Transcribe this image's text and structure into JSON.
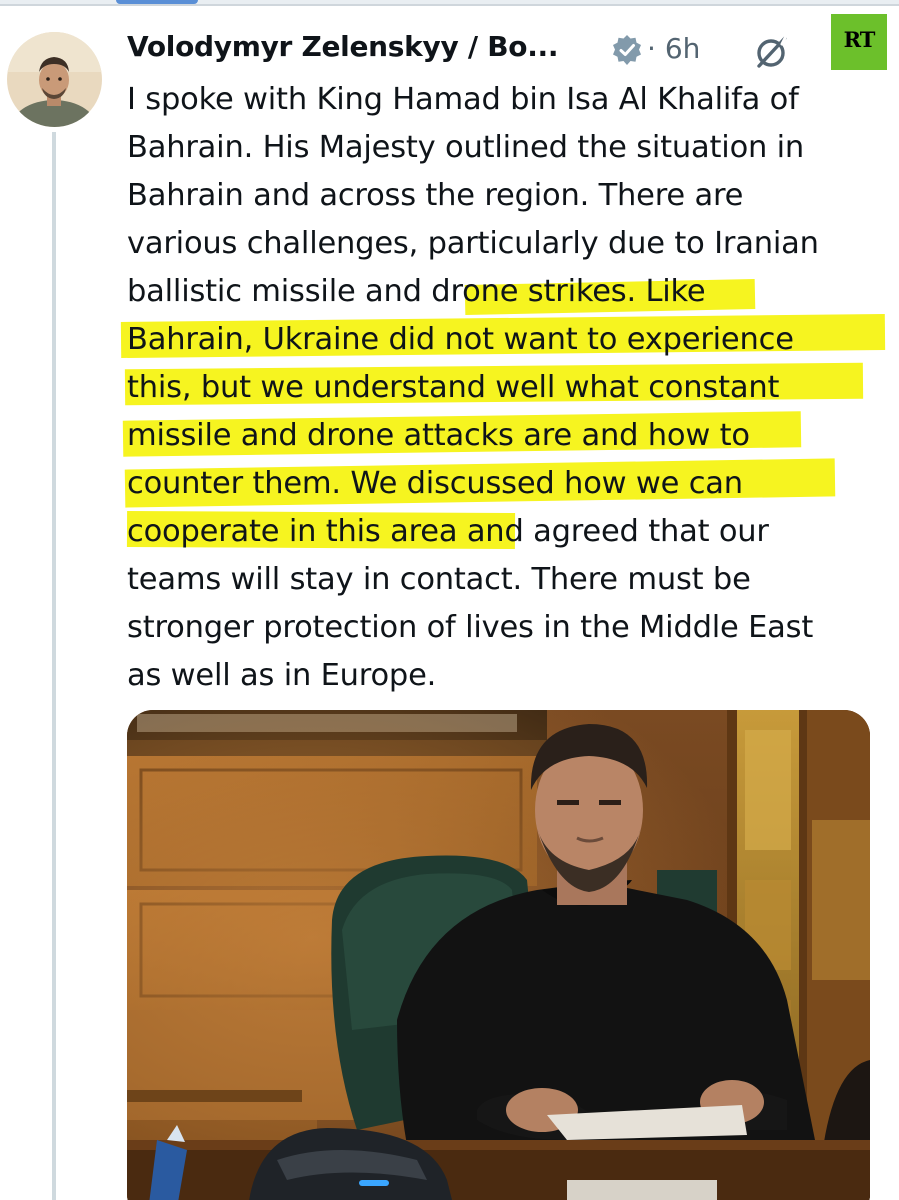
{
  "tweet": {
    "author_name": "Volodymyr Zelenskyy / Bo...",
    "separator": "·",
    "time_ago": "6h",
    "body_lines": [
      "I spoke with King Hamad bin Isa Al Khalifa of",
      "Bahrain. His Majesty outlined the situation in",
      "Bahrain and across the region. There are",
      "various challenges, particularly due to Iranian",
      "ballistic missile and drone strikes. Like",
      "Bahrain, Ukraine did not want to experience",
      "this, but we understand well what constant",
      "missile and drone attacks are and how to",
      "counter them. We discussed how we can",
      "cooperate in this area and agreed that our",
      "teams will stay in contact. There must be",
      "stronger protection of lives in the Middle East",
      "as well as in Europe."
    ],
    "highlight_color": "#f6f420"
  },
  "watermark": {
    "text": "RT",
    "color": "#6cc02b"
  },
  "icons": {
    "verified": "verified-badge-icon",
    "grok": "grok-icon"
  },
  "colors": {
    "text": "#0f1419",
    "secondary": "#536471",
    "thread_line": "#cfd9de"
  }
}
